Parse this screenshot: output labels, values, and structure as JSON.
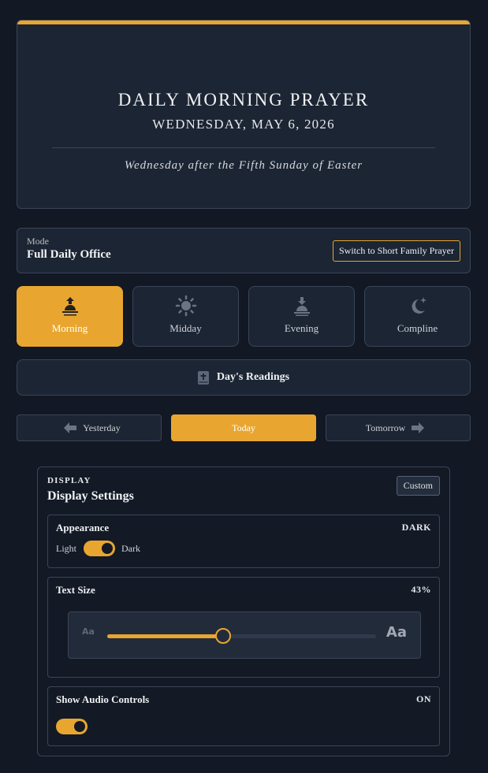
{
  "header": {
    "title": "DAILY MORNING PRAYER",
    "date": "WEDNESDAY, MAY 6, 2026",
    "season": "Wednesday after the Fifth Sunday of Easter"
  },
  "mode": {
    "label": "Mode",
    "value": "Full Daily Office",
    "switch_label": "Switch to Short Family Prayer"
  },
  "offices": [
    {
      "label": "Morning",
      "icon": "sunrise-icon",
      "active": true
    },
    {
      "label": "Midday",
      "icon": "sun-icon",
      "active": false
    },
    {
      "label": "Evening",
      "icon": "sunset-icon",
      "active": false
    },
    {
      "label": "Compline",
      "icon": "moon-star-icon",
      "active": false
    }
  ],
  "readings": {
    "label": "Day's Readings",
    "icon": "bible-icon"
  },
  "day_nav": {
    "yesterday": "Yesterday",
    "today": "Today",
    "tomorrow": "Tomorrow"
  },
  "settings": {
    "kicker": "DISPLAY",
    "title": "Display Settings",
    "custom_label": "Custom",
    "appearance": {
      "title": "Appearance",
      "value": "DARK",
      "light_label": "Light",
      "dark_label": "Dark"
    },
    "text_size": {
      "title": "Text Size",
      "value": "43%",
      "level": 0.43,
      "small_glyph": "Aa",
      "large_glyph": "Aa"
    },
    "audio": {
      "title": "Show Audio Controls",
      "value": "ON"
    }
  },
  "colors": {
    "accent": "#e8a630",
    "background": "#121824",
    "card": "#1c2533"
  }
}
